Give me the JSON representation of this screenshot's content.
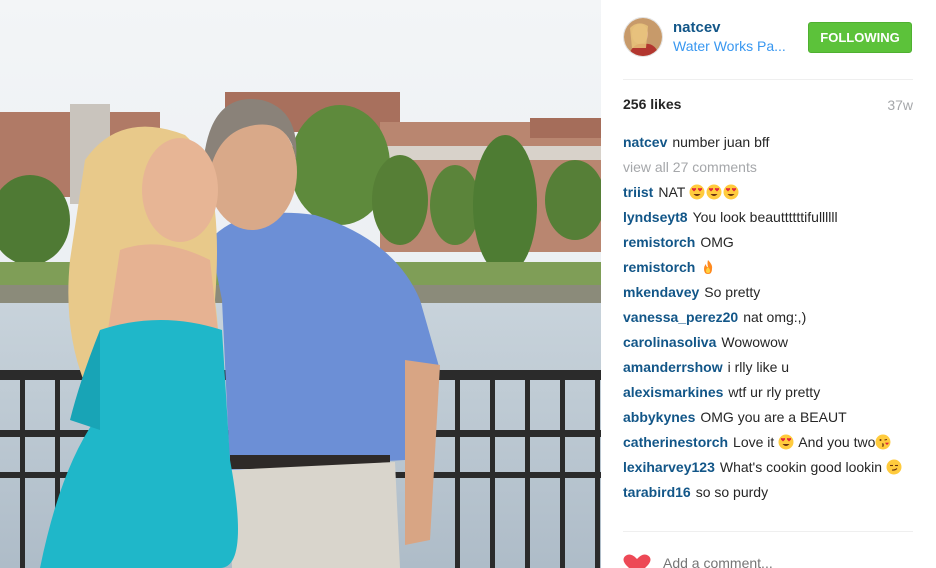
{
  "post": {
    "username": "natcev",
    "location": "Water Works Pa...",
    "follow_label": "FOLLOWING",
    "likes": "256 likes",
    "age": "37w"
  },
  "caption": {
    "user": "natcev",
    "text": "number juan bff"
  },
  "view_all": "view all 27 comments",
  "comments": [
    {
      "user": "triist",
      "text": "NAT",
      "emoji": [
        "heart-eyes",
        "heart-eyes",
        "heart-eyes"
      ]
    },
    {
      "user": "lyndseyt8",
      "text": "You look beauttttttifullllll"
    },
    {
      "user": "remistorch",
      "text": "OMG"
    },
    {
      "user": "remistorch",
      "text": "",
      "emoji": [
        "fire"
      ]
    },
    {
      "user": "mkendavey",
      "text": "So pretty"
    },
    {
      "user": "vanessa_perez20",
      "text": "nat omg:,)"
    },
    {
      "user": "carolinasoliva",
      "text": "Wowowow"
    },
    {
      "user": "amanderrshow",
      "text": "i rlly like u"
    },
    {
      "user": "alexismarkines",
      "text": "wtf ur rly pretty"
    },
    {
      "user": "abbykynes",
      "text": "OMG you are a BEAUT"
    },
    {
      "user": "catherinestorch",
      "text": "Love it",
      "emoji": [
        "heart-eyes"
      ],
      "text2": " And you two",
      "emoji2": [
        "kiss"
      ]
    },
    {
      "user": "lexiharvey123",
      "text": "What's cookin good lookin",
      "emoji": [
        "smirk"
      ]
    },
    {
      "user": "tarabird16",
      "text": "so so purdy"
    }
  ],
  "add_comment_placeholder": "Add a comment...",
  "more_label": "...",
  "colors": {
    "username": "#125688",
    "follow": "#5cc23a",
    "location": "#3897f0",
    "muted": "#a5a7aa",
    "heart": "#ed4956"
  }
}
